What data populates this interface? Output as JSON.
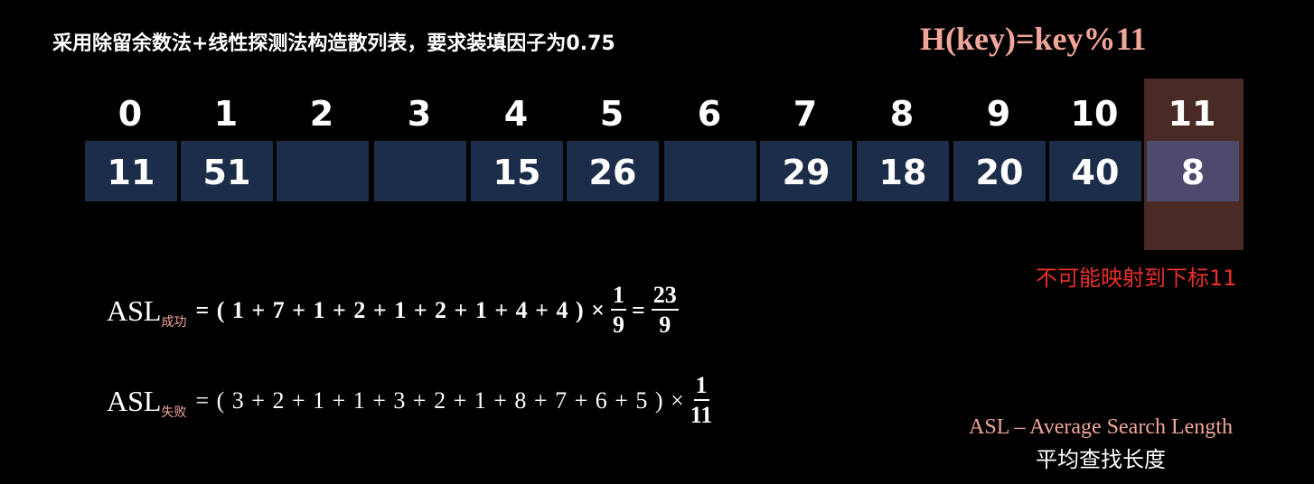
{
  "title": "采用除留余数法+线性探测法构造散列表，要求装填因子为0.75",
  "hash_function": "H(key)=key%11",
  "table": {
    "indices": [
      "0",
      "1",
      "2",
      "3",
      "4",
      "5",
      "6",
      "7",
      "8",
      "9",
      "10",
      "11"
    ],
    "values": [
      "11",
      "51",
      "",
      "",
      "15",
      "26",
      "",
      "29",
      "18",
      "20",
      "40",
      "8"
    ],
    "highlight_color": "#4a2a25",
    "cell_color": "#1c2d4a"
  },
  "note_index11": "不可能映射到下标11",
  "asl_success": {
    "label": "ASL",
    "sub": "成功",
    "expr": "= ( 1 + 7 + 1 + 2 + 1 + 2 + 1 + 4 + 4 ) ×",
    "frac1_num": "1",
    "frac1_den": "9",
    "eq": "=",
    "frac2_num": "23",
    "frac2_den": "9"
  },
  "asl_fail": {
    "label": "ASL",
    "sub": "失败",
    "expr": "= ( 3 + 2 + 1 + 1 + 3 + 2 + 1 + 8 + 7 + 6 + 5 ) ×",
    "frac_num": "1",
    "frac_den": "11"
  },
  "legend": {
    "en": "ASL – Average Search Length",
    "cn": "平均查找长度"
  }
}
